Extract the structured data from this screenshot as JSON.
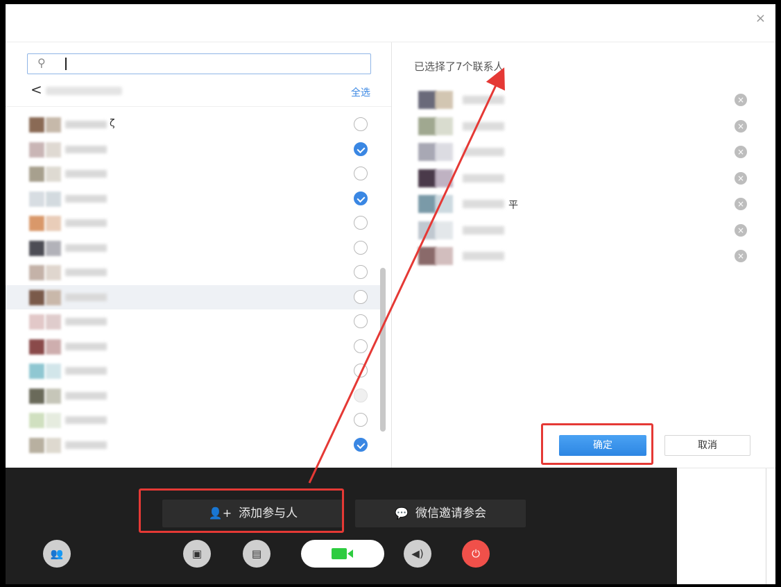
{
  "dialog": {
    "close_glyph": "×",
    "search": {
      "placeholder": ""
    },
    "breadcrumb_back": "<",
    "select_all": "全选",
    "selected_title": "已选择了7个联系人",
    "ok_label": "确定",
    "cancel_label": "取消"
  },
  "contacts": [
    {
      "name_fragment": "ζ",
      "checked": false,
      "disabled": false,
      "highlight": false,
      "color1": "#8a6a55",
      "color2": "#b9a896"
    },
    {
      "name_fragment": "",
      "checked": true,
      "disabled": false,
      "highlight": false,
      "color1": "#c9b5b5",
      "color2": "#d8d0c8"
    },
    {
      "name_fragment": "",
      "checked": false,
      "disabled": false,
      "highlight": false,
      "color1": "#a7a08e",
      "color2": "#d7d2c8"
    },
    {
      "name_fragment": "",
      "checked": true,
      "disabled": false,
      "highlight": false,
      "color1": "#d7dde2",
      "color2": "#c9d2d8"
    },
    {
      "name_fragment": "",
      "checked": false,
      "disabled": false,
      "highlight": false,
      "color1": "#d9986a",
      "color2": "#e4c1a8"
    },
    {
      "name_fragment": "",
      "checked": false,
      "disabled": false,
      "highlight": false,
      "color1": "#4d4d55",
      "color2": "#a0a0a8"
    },
    {
      "name_fragment": "",
      "checked": false,
      "disabled": false,
      "highlight": false,
      "color1": "#c4b2a8",
      "color2": "#d8ccc2"
    },
    {
      "name_fragment": "",
      "checked": false,
      "disabled": false,
      "highlight": true,
      "color1": "#7a5a4a",
      "color2": "#c0aa98"
    },
    {
      "name_fragment": "",
      "checked": false,
      "disabled": false,
      "highlight": false,
      "color1": "#e2c8c8",
      "color2": "#d8c0c0"
    },
    {
      "name_fragment": "",
      "checked": false,
      "disabled": false,
      "highlight": false,
      "color1": "#8a4a4a",
      "color2": "#c29a9a"
    },
    {
      "name_fragment": "",
      "checked": false,
      "disabled": false,
      "highlight": false,
      "color1": "#8fc7d2",
      "color2": "#c8e0e6"
    },
    {
      "name_fragment": "",
      "checked": false,
      "disabled": true,
      "highlight": false,
      "color1": "#6a6a5a",
      "color2": "#b8b8a8"
    },
    {
      "name_fragment": "",
      "checked": false,
      "disabled": false,
      "highlight": false,
      "color1": "#d0e0c0",
      "color2": "#e0e8d8"
    },
    {
      "name_fragment": "",
      "checked": true,
      "disabled": false,
      "highlight": false,
      "color1": "#b8b0a0",
      "color2": "#d6d0c4"
    }
  ],
  "selected": [
    {
      "name_fragment": "",
      "color1": "#6a6a7a",
      "color2": "#c8b8a0"
    },
    {
      "name_fragment": "",
      "color1": "#a0a890",
      "color2": "#d0d4c4"
    },
    {
      "name_fragment": "",
      "color1": "#a8a8b4",
      "color2": "#d4d4dc"
    },
    {
      "name_fragment": "",
      "color1": "#4a3a4a",
      "color2": "#b0a0b4"
    },
    {
      "name_fragment": "平",
      "color1": "#7a9aa8",
      "color2": "#c0d0d8"
    },
    {
      "name_fragment": "",
      "color1": "#c0c8d0",
      "color2": "#dde2e6"
    },
    {
      "name_fragment": "",
      "color1": "#8a6a6a",
      "color2": "#c8aeae"
    }
  ],
  "bottom": {
    "add_participant": "添加参与人",
    "wechat_invite": "微信邀请参会"
  },
  "colors": {
    "accent": "#3a87e3",
    "annotation_red": "#e53935",
    "bar_bg": "#1f1f1f",
    "hangup": "#f0504a",
    "video_green": "#2ecc40"
  },
  "icons": {
    "participants": "participants-icon",
    "share_screen": "share-screen-icon",
    "share_file": "share-file-icon",
    "video": "video-camera-icon",
    "speaker": "speaker-icon",
    "hangup": "power-icon",
    "add_user": "add-user-icon",
    "wechat": "wechat-icon",
    "search": "search-icon"
  }
}
